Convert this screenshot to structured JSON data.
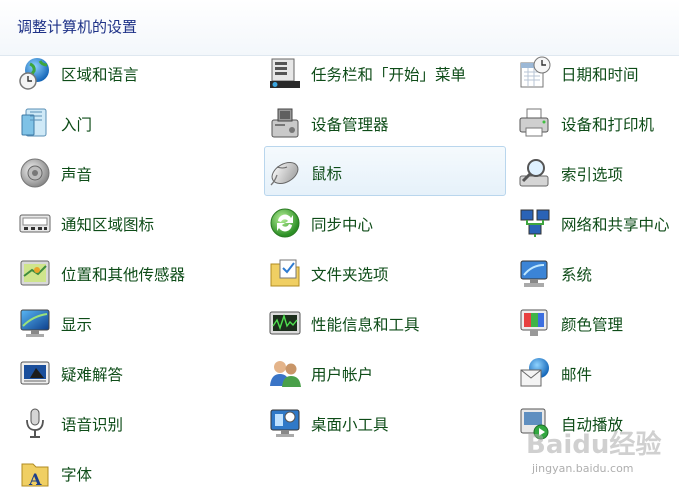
{
  "header": {
    "title": "调整计算机的设置"
  },
  "items": [
    {
      "label": "区域和语言",
      "icon": "globe-clock-icon"
    },
    {
      "label": "任务栏和「开始」菜单",
      "icon": "taskbar-icon"
    },
    {
      "label": "日期和时间",
      "icon": "calendar-clock-icon"
    },
    {
      "label": "入门",
      "icon": "getting-started-icon"
    },
    {
      "label": "设备管理器",
      "icon": "device-manager-icon"
    },
    {
      "label": "设备和打印机",
      "icon": "printer-icon"
    },
    {
      "label": "声音",
      "icon": "speaker-icon"
    },
    {
      "label": "鼠标",
      "icon": "mouse-icon"
    },
    {
      "label": "索引选项",
      "icon": "magnifier-icon"
    },
    {
      "label": "通知区域图标",
      "icon": "notification-area-icon"
    },
    {
      "label": "同步中心",
      "icon": "sync-icon"
    },
    {
      "label": "网络和共享中心",
      "icon": "network-icon"
    },
    {
      "label": "位置和其他传感器",
      "icon": "location-sensor-icon"
    },
    {
      "label": "文件夹选项",
      "icon": "folder-options-icon"
    },
    {
      "label": "系统",
      "icon": "system-icon"
    },
    {
      "label": "显示",
      "icon": "display-icon"
    },
    {
      "label": "性能信息和工具",
      "icon": "performance-icon"
    },
    {
      "label": "颜色管理",
      "icon": "color-management-icon"
    },
    {
      "label": "疑难解答",
      "icon": "troubleshooting-icon"
    },
    {
      "label": "用户帐户",
      "icon": "user-accounts-icon"
    },
    {
      "label": "邮件",
      "icon": "mail-icon"
    },
    {
      "label": "语音识别",
      "icon": "microphone-icon"
    },
    {
      "label": "桌面小工具",
      "icon": "gadgets-icon"
    },
    {
      "label": "自动播放",
      "icon": "autoplay-icon"
    },
    {
      "label": "字体",
      "icon": "fonts-icon"
    }
  ],
  "selected_item": "鼠标",
  "watermark": {
    "logo": "Baidu经验",
    "url": "jingyan.baidu.com"
  }
}
